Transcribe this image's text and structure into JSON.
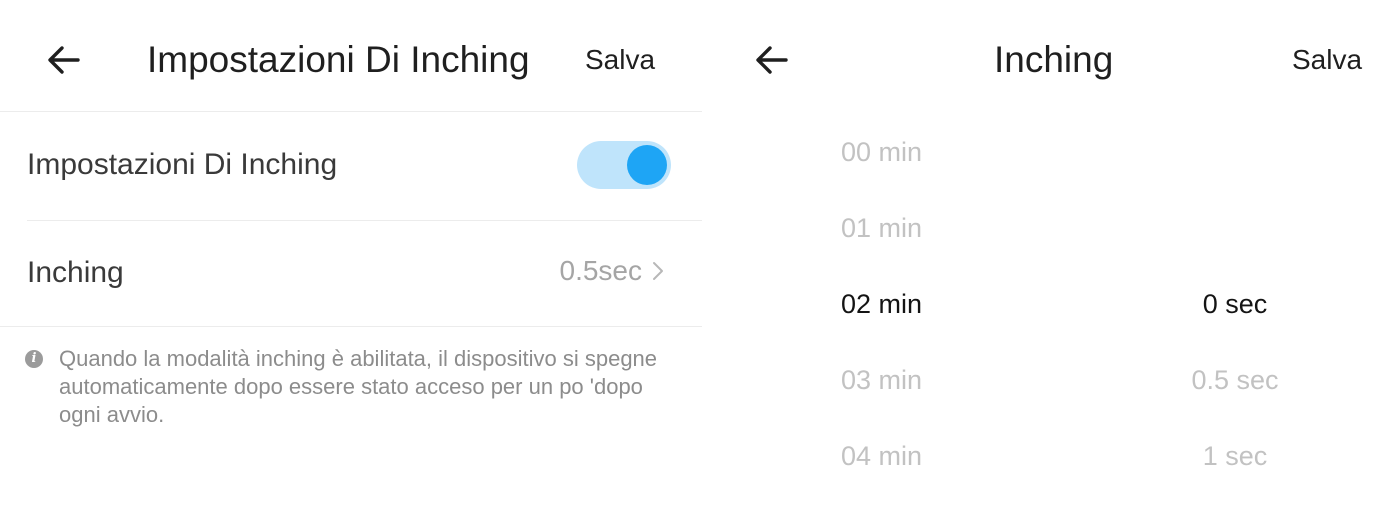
{
  "left_screen": {
    "header": {
      "title": "Impostazioni Di Inching",
      "save_label": "Salva"
    },
    "inching_toggle": {
      "label": "Impostazioni Di Inching",
      "enabled": true
    },
    "inching_row": {
      "label": "Inching",
      "value": "0.5sec"
    },
    "info": {
      "text": "Quando la modalità inching è abilitata, il dispositivo si spegne automaticamente dopo essere stato acceso per un po 'dopo ogni avvio."
    }
  },
  "right_screen": {
    "header": {
      "title": "Inching",
      "save_label": "Salva"
    },
    "minutes_picker": {
      "items": [
        "00 min",
        "01 min",
        "02 min",
        "03 min",
        "04 min"
      ],
      "selected": "02 min"
    },
    "seconds_picker": {
      "items": [
        "0 sec",
        "0.5 sec",
        "1 sec"
      ],
      "selected": "0 sec"
    }
  },
  "colors": {
    "toggle_track": "#bfe4fb",
    "toggle_knob": "#1ea5f5",
    "faded_text": "#c2c2c2",
    "selected_text": "#141414"
  },
  "icons": {
    "back": "arrow-left-icon",
    "chevron": "chevron-right-icon",
    "info": "info-circle-icon"
  }
}
